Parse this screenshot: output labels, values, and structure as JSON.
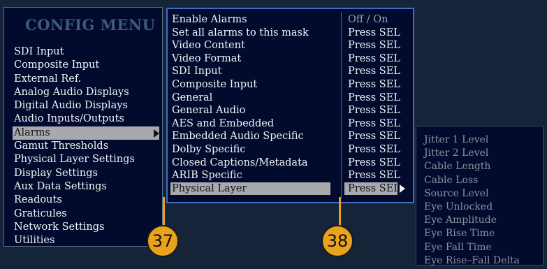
{
  "config_menu": {
    "title": "CONFIG MENU",
    "items": [
      {
        "label": "SDI Input"
      },
      {
        "label": "Composite Input"
      },
      {
        "label": "External Ref."
      },
      {
        "label": "Analog Audio Displays"
      },
      {
        "label": "Digital Audio Displays"
      },
      {
        "label": "Audio Inputs/Outputs"
      },
      {
        "label": "Alarms",
        "selected": true
      },
      {
        "label": "Gamut Thresholds"
      },
      {
        "label": "Physical Layer Settings"
      },
      {
        "label": "Display Settings"
      },
      {
        "label": "Aux Data Settings"
      },
      {
        "label": "Readouts"
      },
      {
        "label": "Graticules"
      },
      {
        "label": "Network Settings"
      },
      {
        "label": "Utilities"
      }
    ]
  },
  "alarms_menu": {
    "rows": [
      {
        "label": "Enable Alarms",
        "value": "Off / On"
      },
      {
        "label": "Set all alarms to this mask",
        "value": "Press SEL"
      },
      {
        "label": "Video Content",
        "value": "Press SEL"
      },
      {
        "label": "Video Format",
        "value": "Press SEL"
      },
      {
        "label": "SDI Input",
        "value": "Press SEL"
      },
      {
        "label": "Composite Input",
        "value": "Press SEL"
      },
      {
        "label": "General",
        "value": "Press SEL"
      },
      {
        "label": "General Audio",
        "value": "Press SEL"
      },
      {
        "label": "AES and Embedded",
        "value": "Press SEL"
      },
      {
        "label": "Embedded Audio Specific",
        "value": "Press SEL"
      },
      {
        "label": "Dolby Specific",
        "value": "Press SEL"
      },
      {
        "label": "Closed Captions/Metadata",
        "value": "Press SEL"
      },
      {
        "label": "ARIB Specific",
        "value": "Press SEL"
      },
      {
        "label": "Physical Layer",
        "value": "Press SEL",
        "selected": true
      }
    ]
  },
  "physical_layer_menu": {
    "items": [
      "Jitter 1 Level",
      "Jitter 2 Level",
      "Cable Length",
      "Cable Loss",
      "Source Level",
      "Eye Unlocked",
      "Eye Amplitude",
      "Eye Rise Time",
      "Eye Fall Time",
      "Eye Rise–Fall Delta"
    ]
  },
  "callouts": {
    "left": "37",
    "right": "38",
    "color": "#e9a21c"
  },
  "colors": {
    "background": "#16243a",
    "panel": "#020a2d",
    "highlight": "#a7a9ac",
    "accent_border": "#3e6ec0",
    "title": "#3c5a84"
  }
}
